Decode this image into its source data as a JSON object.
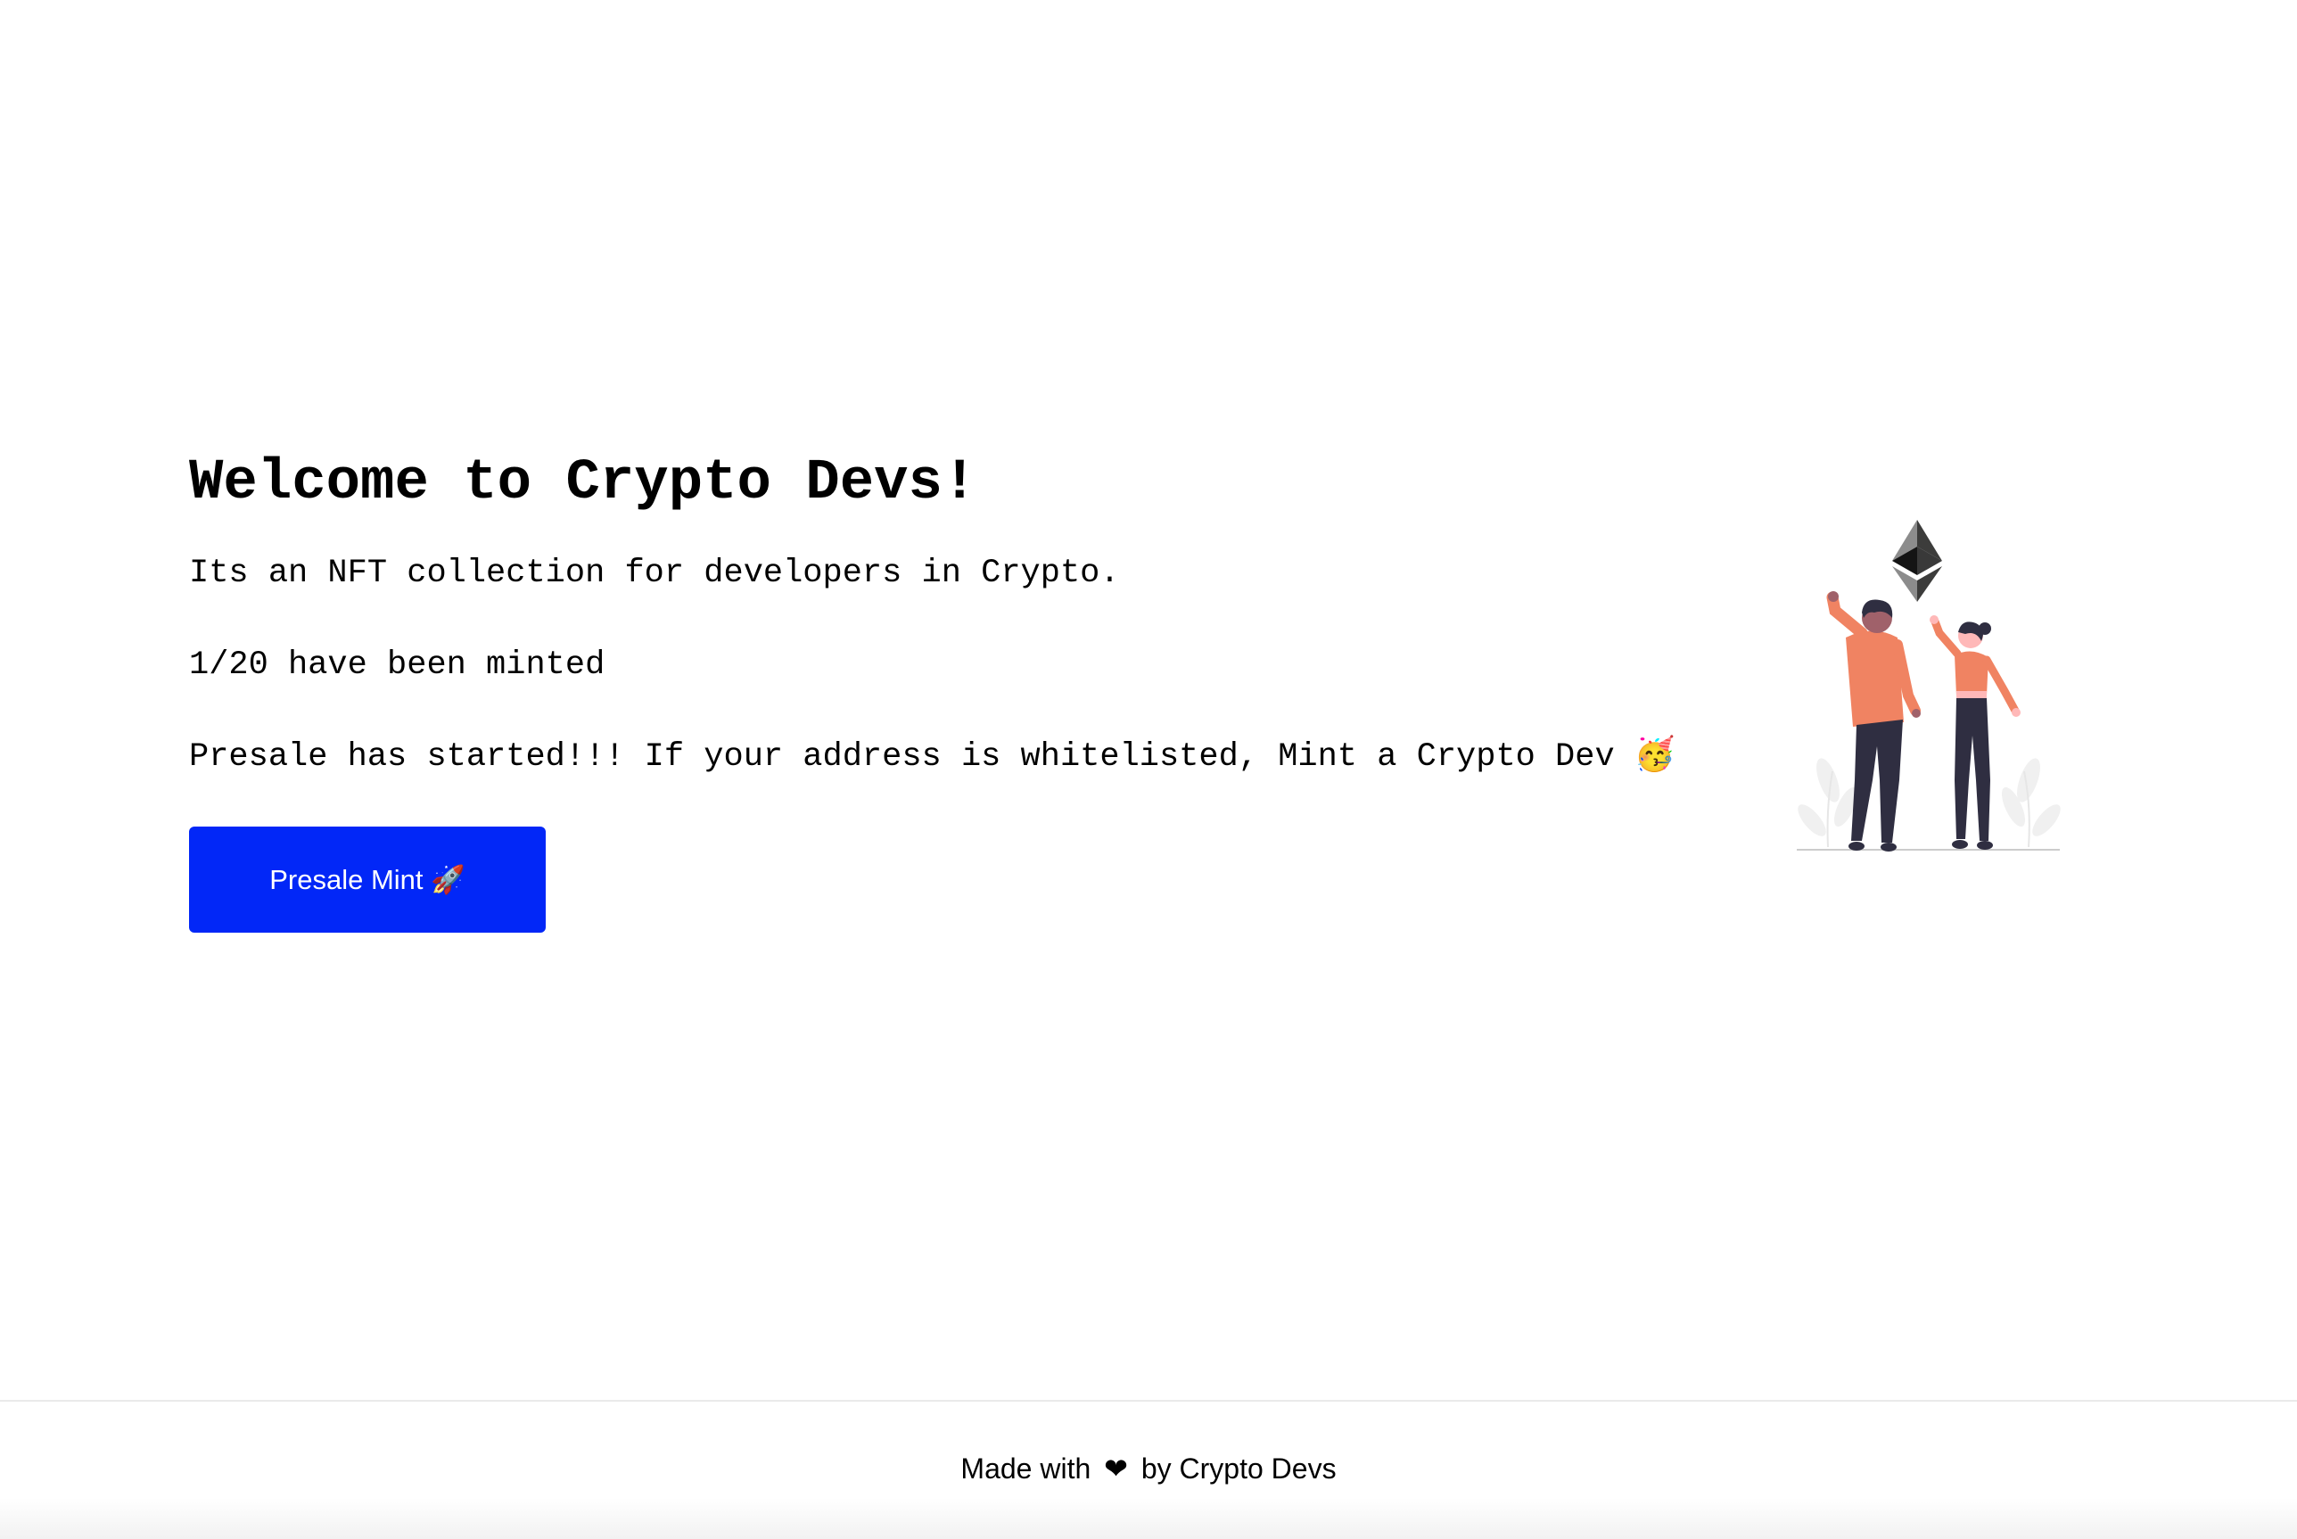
{
  "hero": {
    "title": "Welcome to Crypto Devs!",
    "description": "Its an NFT collection for developers in Crypto.",
    "minted_status": "1/20 have been minted",
    "presale_message": "Presale has started!!! If your address is whitelisted, Mint a Crypto Dev 🥳",
    "mint_button_label": "Presale Mint 🚀"
  },
  "illustration": {
    "icon": "ethereum-people-celebrating-illustration"
  },
  "footer": {
    "prefix": "Made with",
    "heart": "❤",
    "suffix": "by Crypto Devs"
  },
  "colors": {
    "button_bg": "#0227f7",
    "button_text": "#ffffff",
    "person_shirt": "#f08362",
    "person_pants": "#2f2e41"
  }
}
